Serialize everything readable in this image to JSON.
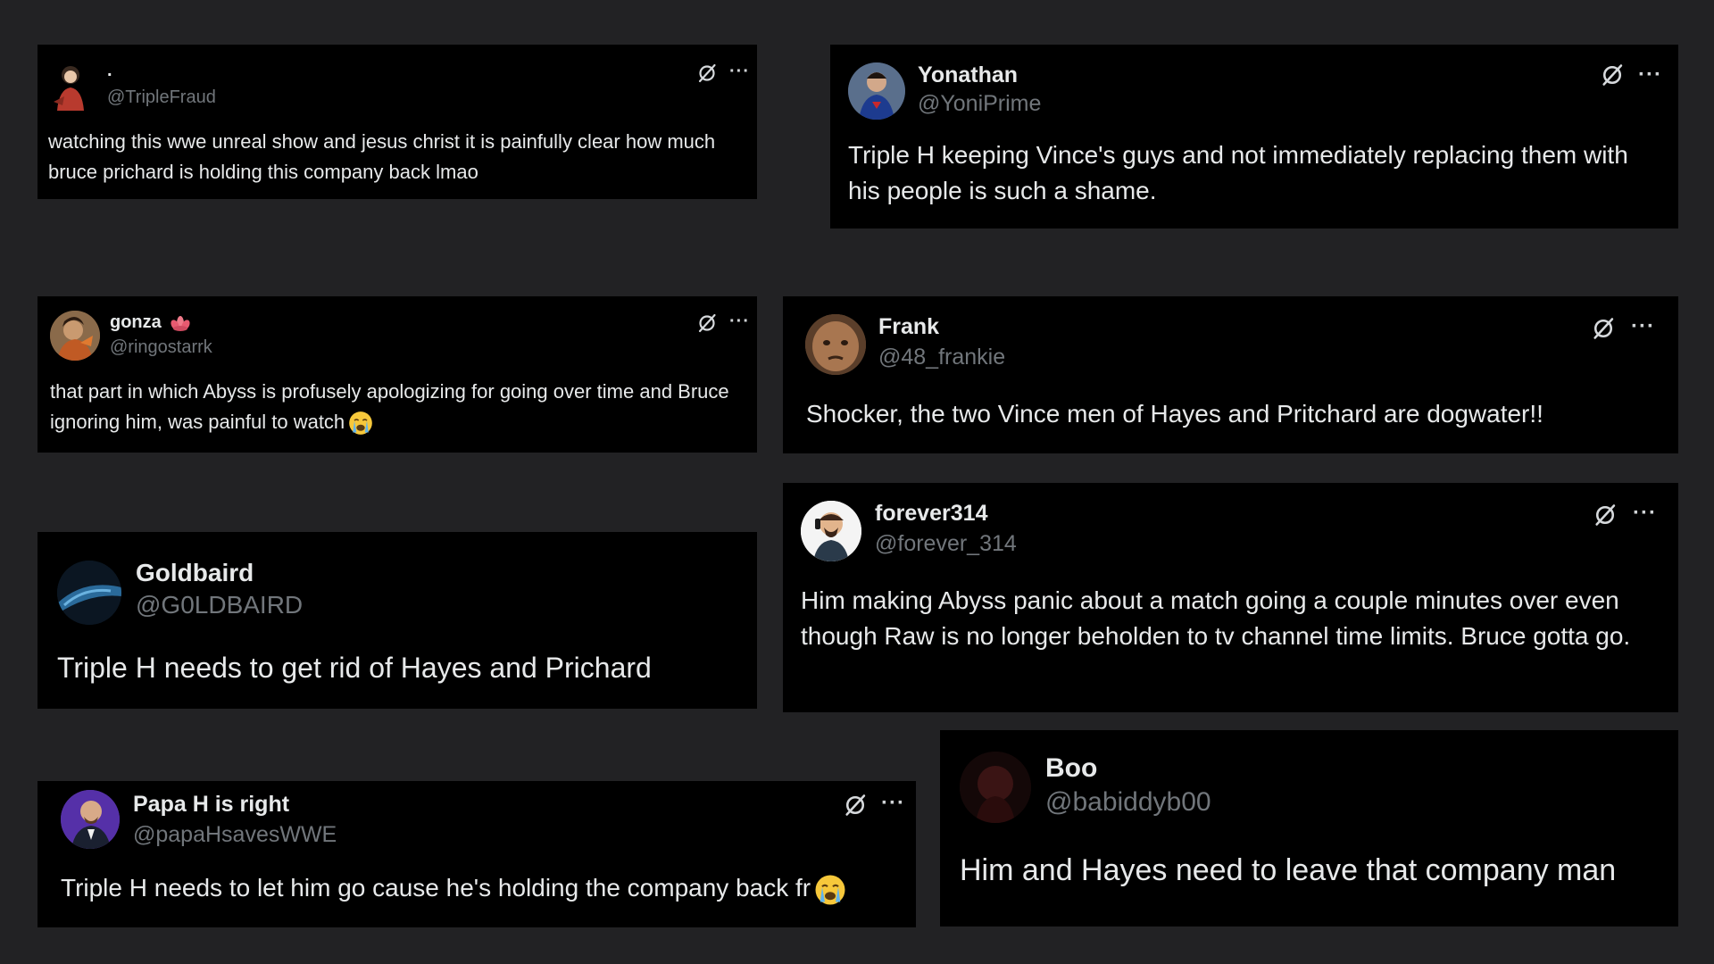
{
  "icons": {
    "grok": "grok-icon",
    "more": "more-options-icon",
    "emoji": "loudly-crying-face-emoji",
    "flower": "flower-emoji"
  },
  "colors": {
    "background": "#222224",
    "card": "#000000",
    "name": "#e7e9ea",
    "handle": "#71767b"
  },
  "tweets": [
    {
      "name": ".",
      "handle": "@TripleFraud",
      "text": "watching this wwe unreal show and jesus christ it is painfully clear how much bruce prichard is holding this company back lmao",
      "more_label": "···"
    },
    {
      "name": "Yonathan",
      "handle": "@YoniPrime",
      "text": "Triple H keeping Vince's guys and not immediately replacing them with his people is such a shame.",
      "more_label": "···"
    },
    {
      "name": "gonza",
      "handle": "@ringostarrk",
      "text": "that part in which Abyss is profusely apologizing for going over time and Bruce ignoring him, was painful to watch",
      "more_label": "···"
    },
    {
      "name": "Frank",
      "handle": "@48_frankie",
      "text": "Shocker, the two Vince men of Hayes and Pritchard are dogwater!!",
      "more_label": "···"
    },
    {
      "name": "Goldbaird",
      "handle": "@G0LDBAIRD",
      "text": "Triple H needs to get rid of Hayes and Prichard"
    },
    {
      "name": "forever314",
      "handle": "@forever_314",
      "text": "Him making Abyss panic about a match going a couple minutes over even though Raw is no longer beholden to tv channel time limits. Bruce gotta go.",
      "more_label": "···"
    },
    {
      "name": "Papa H is right",
      "handle": "@papaHsavesWWE",
      "text": "Triple H needs to let him go cause he's holding the company back fr",
      "more_label": "···"
    },
    {
      "name": "Boo",
      "handle": "@babiddyb00",
      "text": "Him and Hayes need to leave that company man"
    }
  ]
}
